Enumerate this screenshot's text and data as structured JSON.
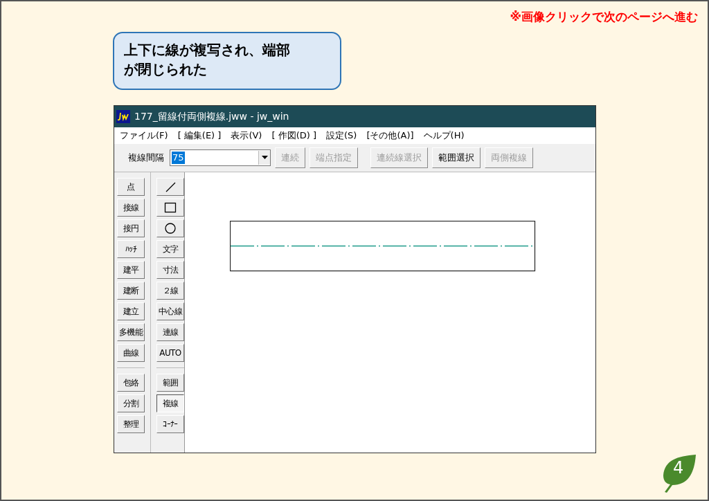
{
  "note": "※画像クリックで次のページへ進む",
  "callout": "上下に線が複写され、端部が閉じられた",
  "window": {
    "title": "177_留線付両側複線.jww - jw_win",
    "menu": [
      "ファイル(F)",
      "[ 編集(E) ]",
      "表示(V)",
      "[ 作図(D) ]",
      "設定(S)",
      "[その他(A)]",
      "ヘルプ(H)"
    ],
    "toolbar": {
      "label": "複線間隔",
      "value": "75",
      "value_selected": true,
      "buttons": [
        {
          "label": "連続",
          "disabled": true
        },
        {
          "label": "端点指定",
          "disabled": true
        },
        {
          "label": "連続線選択",
          "disabled": true
        },
        {
          "label": "範囲選択",
          "disabled": false
        },
        {
          "label": "両側複線",
          "disabled": true
        }
      ]
    },
    "tools_left": [
      [
        {
          "label": "点",
          "selected": false
        },
        {
          "label": "接線",
          "selected": false
        },
        {
          "label": "接円",
          "selected": false
        },
        {
          "label": "ﾊｯﾁ",
          "selected": false
        },
        {
          "label": "建平",
          "selected": false
        },
        {
          "label": "建断",
          "selected": false
        },
        {
          "label": "建立",
          "selected": false
        },
        {
          "label": "多機能",
          "selected": false
        },
        {
          "label": "曲線",
          "selected": false
        }
      ],
      [
        {
          "label": "包絡",
          "selected": false
        },
        {
          "label": "分割",
          "selected": false
        },
        {
          "label": "整理",
          "selected": false
        }
      ]
    ],
    "tools_right": [
      [
        {
          "kind": "line",
          "selected": false
        },
        {
          "kind": "rectangle",
          "selected": false
        },
        {
          "kind": "circle",
          "selected": false
        },
        {
          "kind": "text",
          "label": "文字",
          "selected": false
        },
        {
          "kind": "text",
          "label": "寸法",
          "selected": false
        },
        {
          "kind": "text",
          "label": "２線",
          "selected": false
        },
        {
          "kind": "text",
          "label": "中心線",
          "selected": false
        },
        {
          "kind": "text",
          "label": "連線",
          "selected": false
        },
        {
          "kind": "text",
          "label": "AUTO",
          "selected": false
        }
      ],
      [
        {
          "kind": "text",
          "label": "範囲",
          "selected": false
        },
        {
          "kind": "text",
          "label": "複線",
          "selected": true
        },
        {
          "kind": "text",
          "label": "ｺｰﾅｰ",
          "selected": false
        }
      ]
    ]
  },
  "page_number": "4"
}
